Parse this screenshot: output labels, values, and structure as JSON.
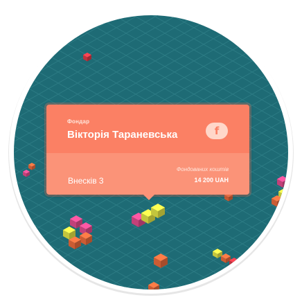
{
  "colors": {
    "board": "#1f6e78",
    "card_header": "#fb8064",
    "card_footer": "#fb9378",
    "text_light": "#ffffff",
    "text_muted": "#ffe6dc",
    "block_pink": "#ec4f93",
    "block_yellow": "#eef04a",
    "block_orange": "#f6703f",
    "block_red": "#e73d4a"
  },
  "card": {
    "role_label": "Фондар",
    "person_name": "Вікторія Тараневська",
    "share_icon": "facebook-icon",
    "share_glyph": "f",
    "contributions_label": "Внесків 3",
    "funded_label": "Фондованих коштів",
    "funded_amount": "14 200 UAH"
  }
}
